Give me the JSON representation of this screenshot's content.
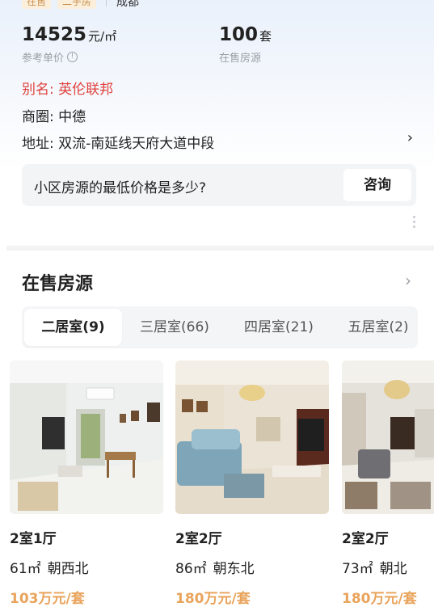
{
  "top": {
    "tags": [
      "在售",
      "二手房"
    ],
    "city": "成都"
  },
  "stats": [
    {
      "value": "14525",
      "unit": "元/㎡",
      "label": "参考单价",
      "has_info": true
    },
    {
      "value": "100",
      "unit": "套",
      "label": "在售房源",
      "has_info": false
    }
  ],
  "details": {
    "alias_label": "别名: 英伦联邦",
    "district": "商圈: 中德",
    "address": "地址: 双流-南延线天府大道中段",
    "chevron": "›"
  },
  "ask": {
    "question": "小区房源的最低价格是多少?",
    "button": "咨询"
  },
  "section": {
    "title": "在售房源",
    "chevron": "›"
  },
  "tabs": [
    {
      "label": "二居室(9)",
      "active": true
    },
    {
      "label": "三居室(66)",
      "active": false
    },
    {
      "label": "四居室(21)",
      "active": false
    },
    {
      "label": "五居室(2)",
      "active": false
    }
  ],
  "listings": [
    {
      "title": "2室1厅",
      "area": "61㎡",
      "orientation": "朝西北",
      "price": "103万元/套"
    },
    {
      "title": "2室2厅",
      "area": "86㎡",
      "orientation": "朝东北",
      "price": "180万元/套"
    },
    {
      "title": "2室2厅",
      "area": "73㎡",
      "orientation": "朝北",
      "price": "180万元/套"
    }
  ]
}
